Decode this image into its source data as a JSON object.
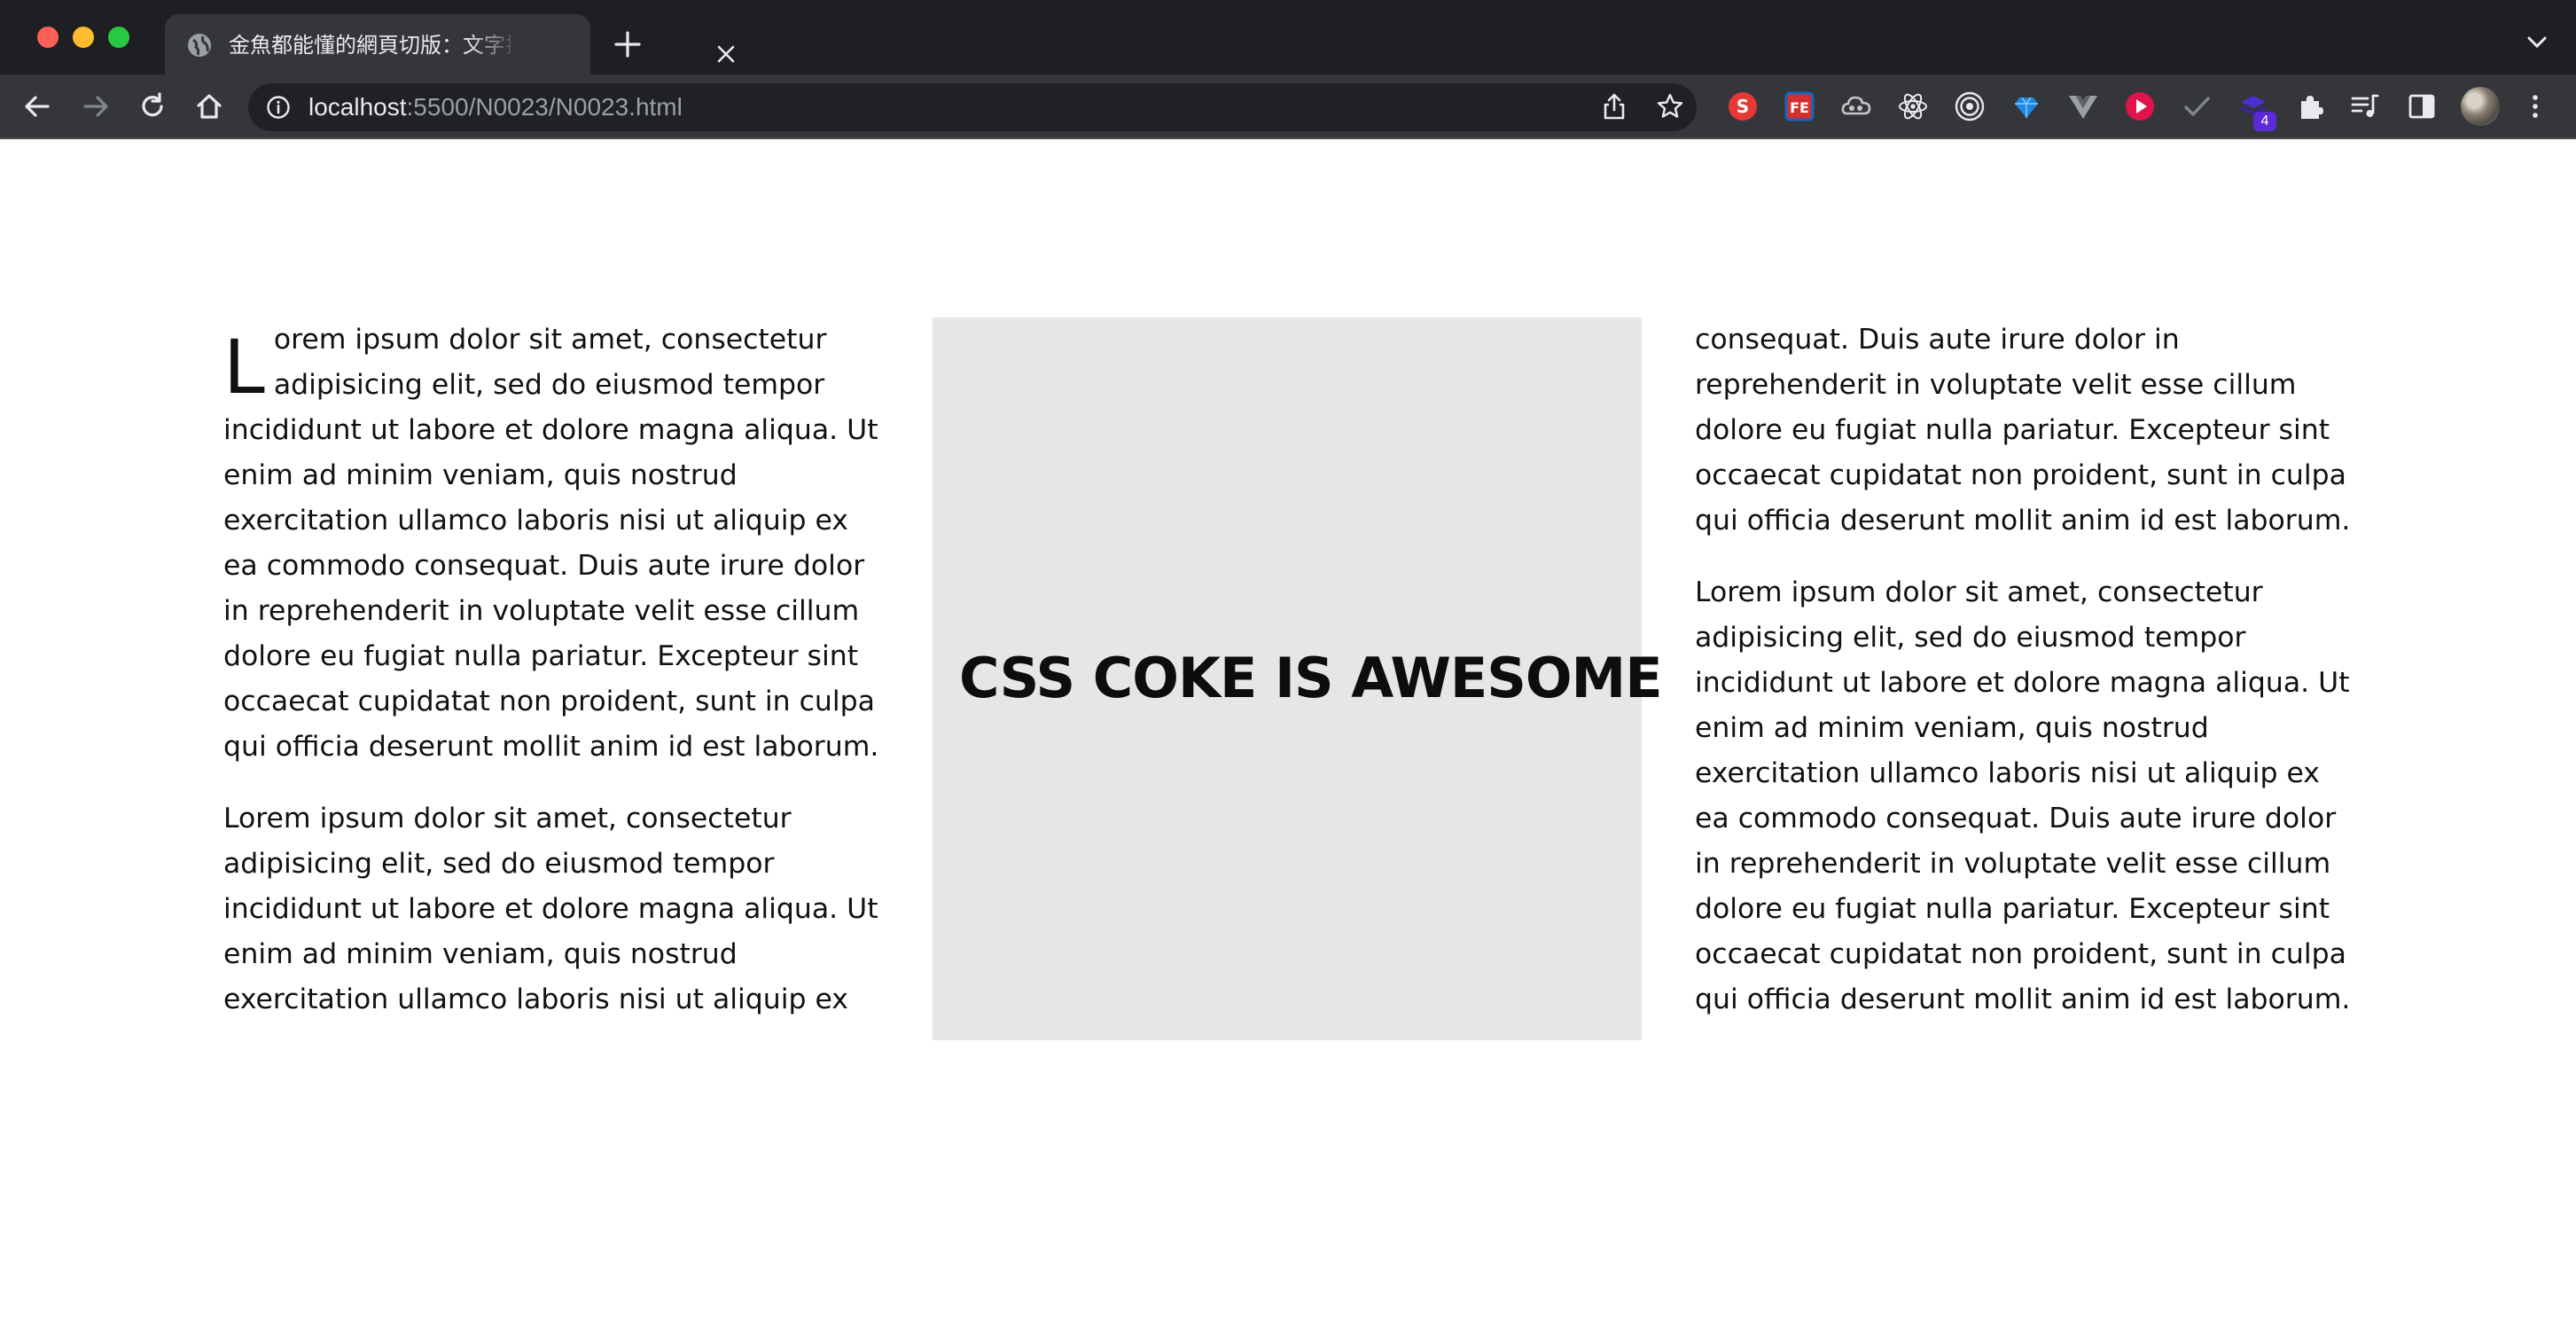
{
  "browser": {
    "tab_title": "金魚都能懂的網頁切版：文字排版",
    "url_host": "localhost",
    "url_path": ":5500/N0023/N0023.html",
    "extension_badge": "4",
    "icons": [
      "globe-icon",
      "close-icon",
      "plus-icon",
      "chevron-down-icon",
      "back-arrow-icon",
      "forward-arrow-icon",
      "reload-icon",
      "home-icon",
      "info-icon",
      "share-icon",
      "star-icon",
      "extensions-puzzle-icon",
      "reading-list-icon",
      "side-panel-icon",
      "more-menu-icon"
    ]
  },
  "page": {
    "left_column": {
      "dropcap": "L",
      "paragraph1_rest": "orem ipsum dolor sit amet, consectetur adipisicing elit, sed do eiusmod tempor incididunt ut labore et dolore magna aliqua. Ut enim ad minim veniam, quis nostrud exercitation ullamco laboris nisi ut aliquip ex ea commodo consequat. Duis aute irure dolor in reprehenderit in voluptate velit esse cillum dolore eu fugiat nulla pariatur. Excepteur sint occaecat cupidatat non proident, sunt in culpa qui officia deserunt mollit anim id est laborum.",
      "paragraph2": "Lorem ipsum dolor sit amet, consectetur adipisicing elit, sed do eiusmod tempor incididunt ut labore et dolore magna aliqua. Ut enim ad minim veniam, quis nostrud exercitation ullamco laboris nisi ut aliquip ex ea commodo"
    },
    "center_heading": "CSS COKE IS AWESOME",
    "right_column": {
      "paragraph1": "consequat. Duis aute irure dolor in reprehenderit in voluptate velit esse cillum dolore eu fugiat nulla pariatur. Excepteur sint occaecat cupidatat non proident, sunt in culpa qui officia deserunt mollit anim id est laborum.",
      "paragraph2": "Lorem ipsum dolor sit amet, consectetur adipisicing elit, sed do eiusmod tempor incididunt ut labore et dolore magna aliqua. Ut enim ad minim veniam, quis nostrud exercitation ullamco laboris nisi ut aliquip ex ea commodo consequat. Duis aute irure dolor in reprehenderit in voluptate velit esse cillum dolore eu fugiat nulla pariatur. Excepteur sint occaecat cupidatat non proident, sunt in culpa qui officia deserunt mollit anim id est laborum."
    }
  },
  "colors": {
    "chrome_dark": "#1e1f22",
    "toolbar": "#35363a",
    "center_box": "#e6e6e6"
  }
}
